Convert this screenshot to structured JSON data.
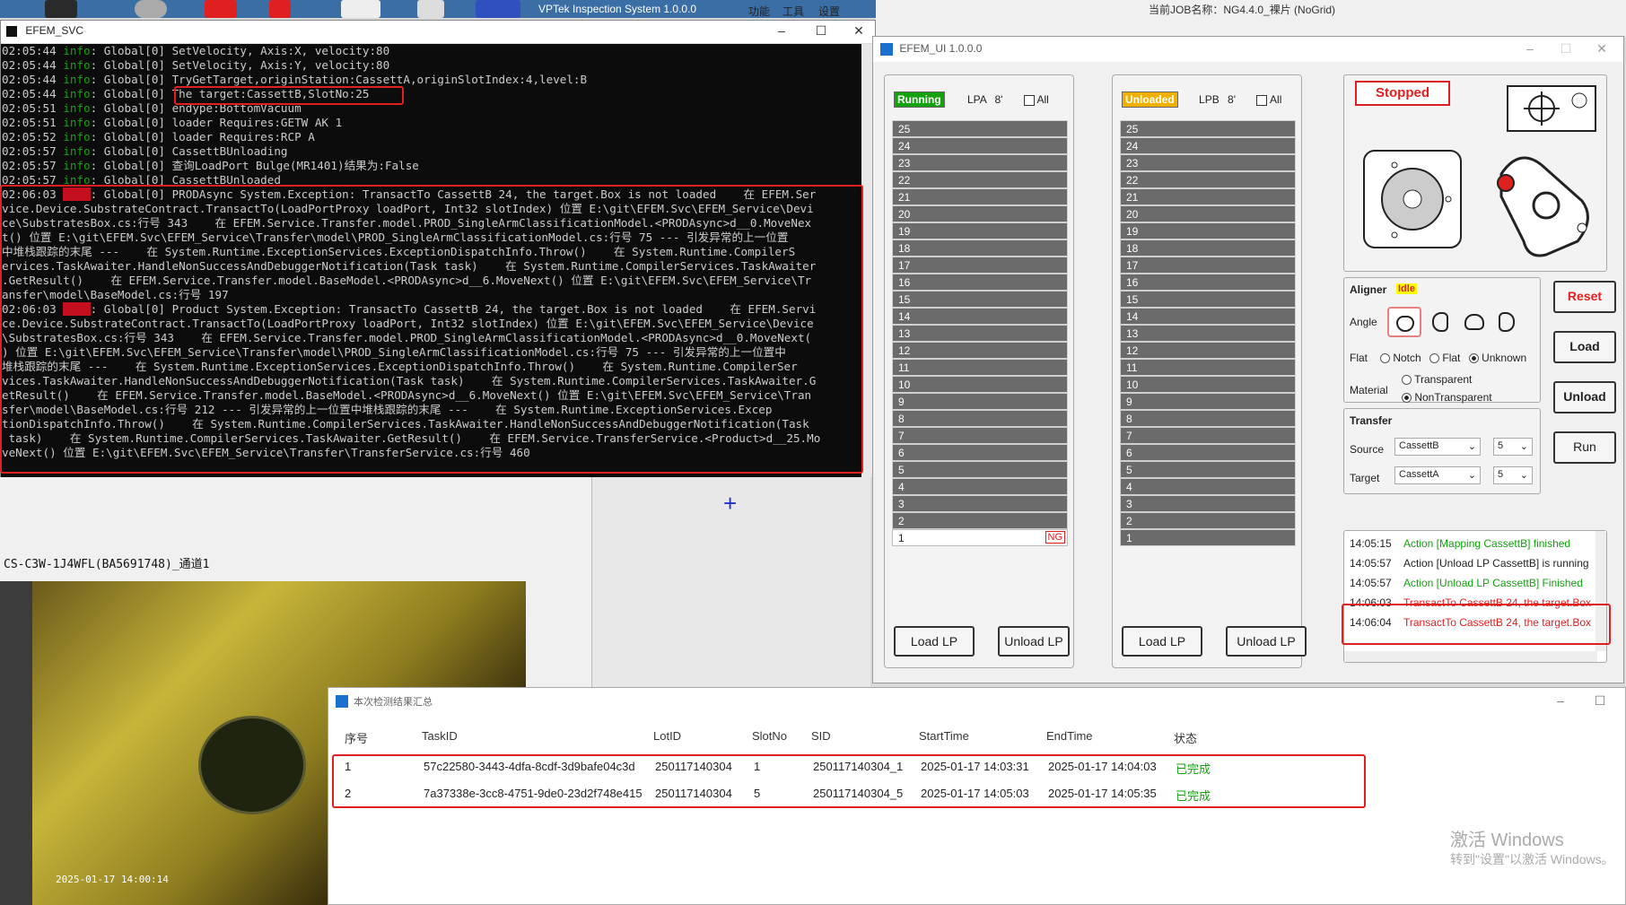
{
  "taskbar": {
    "app_title": "VPTek Inspection System 1.0.0.0",
    "menu_items": [
      "功能",
      "工具",
      "设置"
    ],
    "job_info": "当前JOB名称：NG4.4.0_裸片 (NoGrid)"
  },
  "console": {
    "title": "EFEM_SVC",
    "lines": [
      {
        "time": "02:05:44",
        "level": "info",
        "text": ": Global[0] SetVelocity, Axis:X, velocity:80"
      },
      {
        "time": "02:05:44",
        "level": "info",
        "text": ": Global[0] SetVelocity, Axis:Y, velocity:80"
      },
      {
        "time": "02:05:44",
        "level": "info",
        "text": ": Global[0] TryGetTarget,originStation:CassettA,originSlotIndex:4,level:B"
      },
      {
        "time": "02:05:44",
        "level": "info",
        "text": ": Global[0] The target:CassettB,SlotNo:25"
      },
      {
        "time": "02:05:51",
        "level": "info",
        "text": ": Global[0] endype:BottomVacuum"
      },
      {
        "time": "02:05:51",
        "level": "info",
        "text": ": Global[0] loader Requires:GETW AK 1"
      },
      {
        "time": "02:05:52",
        "level": "info",
        "text": ": Global[0] loader Requires:RCP A"
      },
      {
        "time": "02:05:57",
        "level": "info",
        "text": ": Global[0] CassettBUnloading"
      },
      {
        "time": "02:05:57",
        "level": "info",
        "text": ": Global[0] 查询LoadPort Bulge(MR1401)结果为:False"
      },
      {
        "time": "02:05:57",
        "level": "info",
        "text": ": Global[0] CassettBUnloaded"
      },
      {
        "time": "02:06:03",
        "level": "fail",
        "text": ": Global[0] PRODAsync System.Exception: TransactTo CassettB 24, the target.Box is not loaded    在 EFEM.Ser"
      },
      {
        "time": "",
        "level": "",
        "text": "vice.Device.SubstrateContract.TransactTo(LoadPortProxy loadPort, Int32 slotIndex) 位置 E:\\git\\EFEM.Svc\\EFEM_Service\\Devi"
      },
      {
        "time": "",
        "level": "",
        "text": "ce\\SubstratesBox.cs:行号 343    在 EFEM.Service.Transfer.model.PROD_SingleArmClassificationModel.<PRODAsync>d__0.MoveNex"
      },
      {
        "time": "",
        "level": "",
        "text": "t() 位置 E:\\git\\EFEM.Svc\\EFEM_Service\\Transfer\\model\\PROD_SingleArmClassificationModel.cs:行号 75 --- 引发异常的上一位置"
      },
      {
        "time": "",
        "level": "",
        "text": "中堆栈跟踪的末尾 ---    在 System.Runtime.ExceptionServices.ExceptionDispatchInfo.Throw()    在 System.Runtime.CompilerS"
      },
      {
        "time": "",
        "level": "",
        "text": "ervices.TaskAwaiter.HandleNonSuccessAndDebuggerNotification(Task task)    在 System.Runtime.CompilerServices.TaskAwaiter"
      },
      {
        "time": "",
        "level": "",
        "text": ".GetResult()    在 EFEM.Service.Transfer.model.BaseModel.<PRODAsync>d__6.MoveNext() 位置 E:\\git\\EFEM.Svc\\EFEM_Service\\Tr"
      },
      {
        "time": "",
        "level": "",
        "text": "ansfer\\model\\BaseModel.cs:行号 197"
      },
      {
        "time": "02:06:03",
        "level": "fail",
        "text": ": Global[0] Product System.Exception: TransactTo CassettB 24, the target.Box is not loaded    在 EFEM.Servi"
      },
      {
        "time": "",
        "level": "",
        "text": "ce.Device.SubstrateContract.TransactTo(LoadPortProxy loadPort, Int32 slotIndex) 位置 E:\\git\\EFEM.Svc\\EFEM_Service\\Device"
      },
      {
        "time": "",
        "level": "",
        "text": "\\SubstratesBox.cs:行号 343    在 EFEM.Service.Transfer.model.PROD_SingleArmClassificationModel.<PRODAsync>d__0.MoveNext("
      },
      {
        "time": "",
        "level": "",
        "text": ") 位置 E:\\git\\EFEM.Svc\\EFEM_Service\\Transfer\\model\\PROD_SingleArmClassificationModel.cs:行号 75 --- 引发异常的上一位置中"
      },
      {
        "time": "",
        "level": "",
        "text": "堆栈跟踪的末尾 ---    在 System.Runtime.ExceptionServices.ExceptionDispatchInfo.Throw()    在 System.Runtime.CompilerSer"
      },
      {
        "time": "",
        "level": "",
        "text": "vices.TaskAwaiter.HandleNonSuccessAndDebuggerNotification(Task task)    在 System.Runtime.CompilerServices.TaskAwaiter.G"
      },
      {
        "time": "",
        "level": "",
        "text": "etResult()    在 EFEM.Service.Transfer.model.BaseModel.<PRODAsync>d__6.MoveNext() 位置 E:\\git\\EFEM.Svc\\EFEM_Service\\Tran"
      },
      {
        "time": "",
        "level": "",
        "text": "sfer\\model\\BaseModel.cs:行号 212 --- 引发异常的上一位置中堆栈跟踪的末尾 ---    在 System.Runtime.ExceptionServices.Excep"
      },
      {
        "time": "",
        "level": "",
        "text": "tionDispatchInfo.Throw()    在 System.Runtime.CompilerServices.TaskAwaiter.HandleNonSuccessAndDebuggerNotification(Task"
      },
      {
        "time": "",
        "level": "",
        "text": " task)    在 System.Runtime.CompilerServices.TaskAwaiter.GetResult()    在 EFEM.Service.TransferService.<Product>d__25.Mo"
      },
      {
        "time": "",
        "level": "",
        "text": "veNext() 位置 E:\\git\\EFEM.Svc\\EFEM_Service\\Transfer\\TransferService.cs:行号 460"
      }
    ]
  },
  "camera": {
    "label": "CS-C3W-1J4WFL(BA5691748)_通道1",
    "timestamp": "2025-01-17 14:00:14"
  },
  "efem": {
    "title": "EFEM_UI 1.0.0.0",
    "lpa": {
      "status": "Running",
      "name": "LPA",
      "size": "8'",
      "all_label": "All",
      "slots": [
        "25",
        "24",
        "23",
        "22",
        "21",
        "20",
        "19",
        "18",
        "17",
        "16",
        "15",
        "14",
        "13",
        "12",
        "11",
        "10",
        "9",
        "8",
        "7",
        "6",
        "5",
        "4",
        "3",
        "2",
        "1"
      ],
      "filled_slot": "1",
      "ng_label": "NG",
      "load_label": "Load LP",
      "unload_label": "Unload LP"
    },
    "lpb": {
      "status": "Unloaded",
      "name": "LPB",
      "size": "8'",
      "all_label": "All",
      "slots": [
        "25",
        "24",
        "23",
        "22",
        "21",
        "20",
        "19",
        "18",
        "17",
        "16",
        "15",
        "14",
        "13",
        "12",
        "11",
        "10",
        "9",
        "8",
        "7",
        "6",
        "5",
        "4",
        "3",
        "2",
        "1"
      ],
      "load_label": "Load LP",
      "unload_label": "Unload LP"
    },
    "status": "Stopped",
    "aligner": {
      "label": "Aligner",
      "state": "Idle",
      "angle_label": "Angle",
      "flat_label": "Flat",
      "flat_options": [
        "Notch",
        "Flat",
        "Unknown"
      ],
      "flat_selected": "Unknown",
      "material_label": "Material",
      "material_options": [
        "Transparent",
        "NonTransparent"
      ],
      "material_selected": "NonTransparent"
    },
    "buttons": {
      "reset": "Reset",
      "load": "Load",
      "unload": "Unload",
      "run": "Run"
    },
    "transfer": {
      "label": "Transfer",
      "source_label": "Source",
      "source_value": "CassettB",
      "source_slot": "5",
      "target_label": "Target",
      "target_value": "CassettA",
      "target_slot": "5"
    },
    "log": [
      {
        "time": "14:05:15",
        "text": "Action [Mapping CassettB] finished",
        "color": "#13a10e"
      },
      {
        "time": "14:05:57",
        "text": "Action [Unload LP CassettB] is running",
        "color": "#222222"
      },
      {
        "time": "14:05:57",
        "text": "Action [Unload LP CassettB] Finished",
        "color": "#13a10e"
      },
      {
        "time": "14:06:03",
        "text": "TransactTo CassettB 24, the target.Box",
        "color": "#e02020"
      },
      {
        "time": "14:06:04",
        "text": "TransactTo CassettB 24, the target.Box",
        "color": "#e02020"
      }
    ]
  },
  "summary": {
    "title": "本次检测结果汇总",
    "headers": [
      "序号",
      "TaskID",
      "LotID",
      "SlotNo",
      "SID",
      "StartTime",
      "EndTime",
      "状态"
    ],
    "rows": [
      [
        "1",
        "57c22580-3443-4dfa-8cdf-3d9bafe04c3d",
        "250117140304",
        "1",
        "250117140304_1",
        "2025-01-17 14:03:31",
        "2025-01-17 14:04:03",
        "已完成"
      ],
      [
        "2",
        "7a37338e-3cc8-4751-9de0-23d2f748e415",
        "250117140304",
        "5",
        "250117140304_5",
        "2025-01-17 14:05:03",
        "2025-01-17 14:05:35",
        "已完成"
      ]
    ]
  },
  "watermark": {
    "line1": "激活 Windows",
    "line2": "转到\"设置\"以激活 Windows。"
  }
}
